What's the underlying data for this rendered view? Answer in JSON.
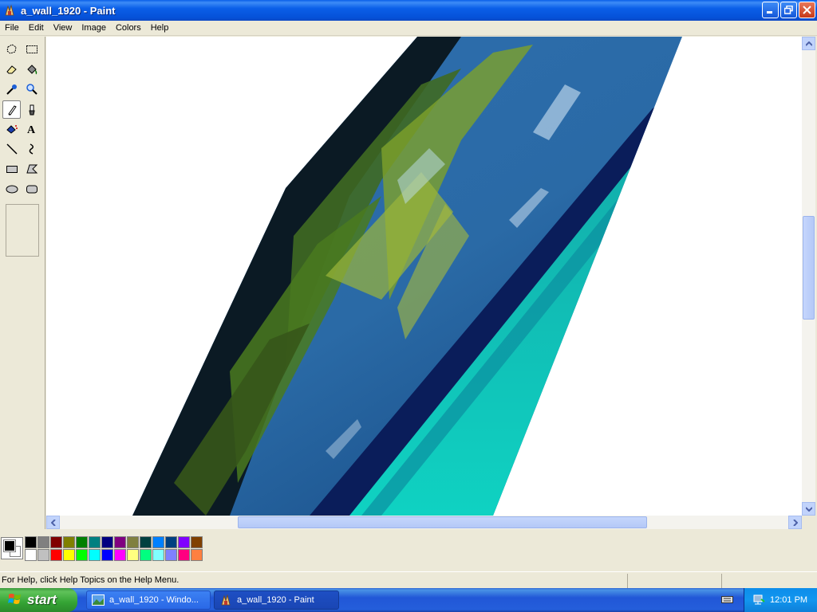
{
  "window": {
    "title": "a_wall_1920 - Paint"
  },
  "menu": {
    "items": [
      "File",
      "Edit",
      "View",
      "Image",
      "Colors",
      "Help"
    ]
  },
  "toolbox": {
    "tools": [
      "free-form-select",
      "rectangle-select",
      "eraser",
      "fill-with-color",
      "pick-color",
      "magnifier",
      "pencil",
      "brush",
      "airbrush",
      "text",
      "line",
      "curve",
      "rectangle",
      "polygon",
      "ellipse",
      "rounded-rectangle"
    ],
    "selected": "pencil"
  },
  "palette": {
    "foreground": "#000000",
    "background": "#ffffff",
    "colors_row1": [
      "#000000",
      "#808080",
      "#800000",
      "#808000",
      "#008000",
      "#008080",
      "#000080",
      "#800080",
      "#808040",
      "#004040",
      "#0080ff",
      "#004080",
      "#8000ff",
      "#804000"
    ],
    "colors_row2": [
      "#ffffff",
      "#c0c0c0",
      "#ff0000",
      "#ffff00",
      "#00ff00",
      "#00ffff",
      "#0000ff",
      "#ff00ff",
      "#ffff80",
      "#00ff80",
      "#80ffff",
      "#8080ff",
      "#ff0080",
      "#ff8040"
    ]
  },
  "status": {
    "text": "For Help, click Help Topics on the Help Menu."
  },
  "taskbar": {
    "start_label": "start",
    "tasks": [
      {
        "label": "a_wall_1920 - Windo..."
      },
      {
        "label": "a_wall_1920 - Paint"
      }
    ],
    "clock": "12:01 PM"
  }
}
